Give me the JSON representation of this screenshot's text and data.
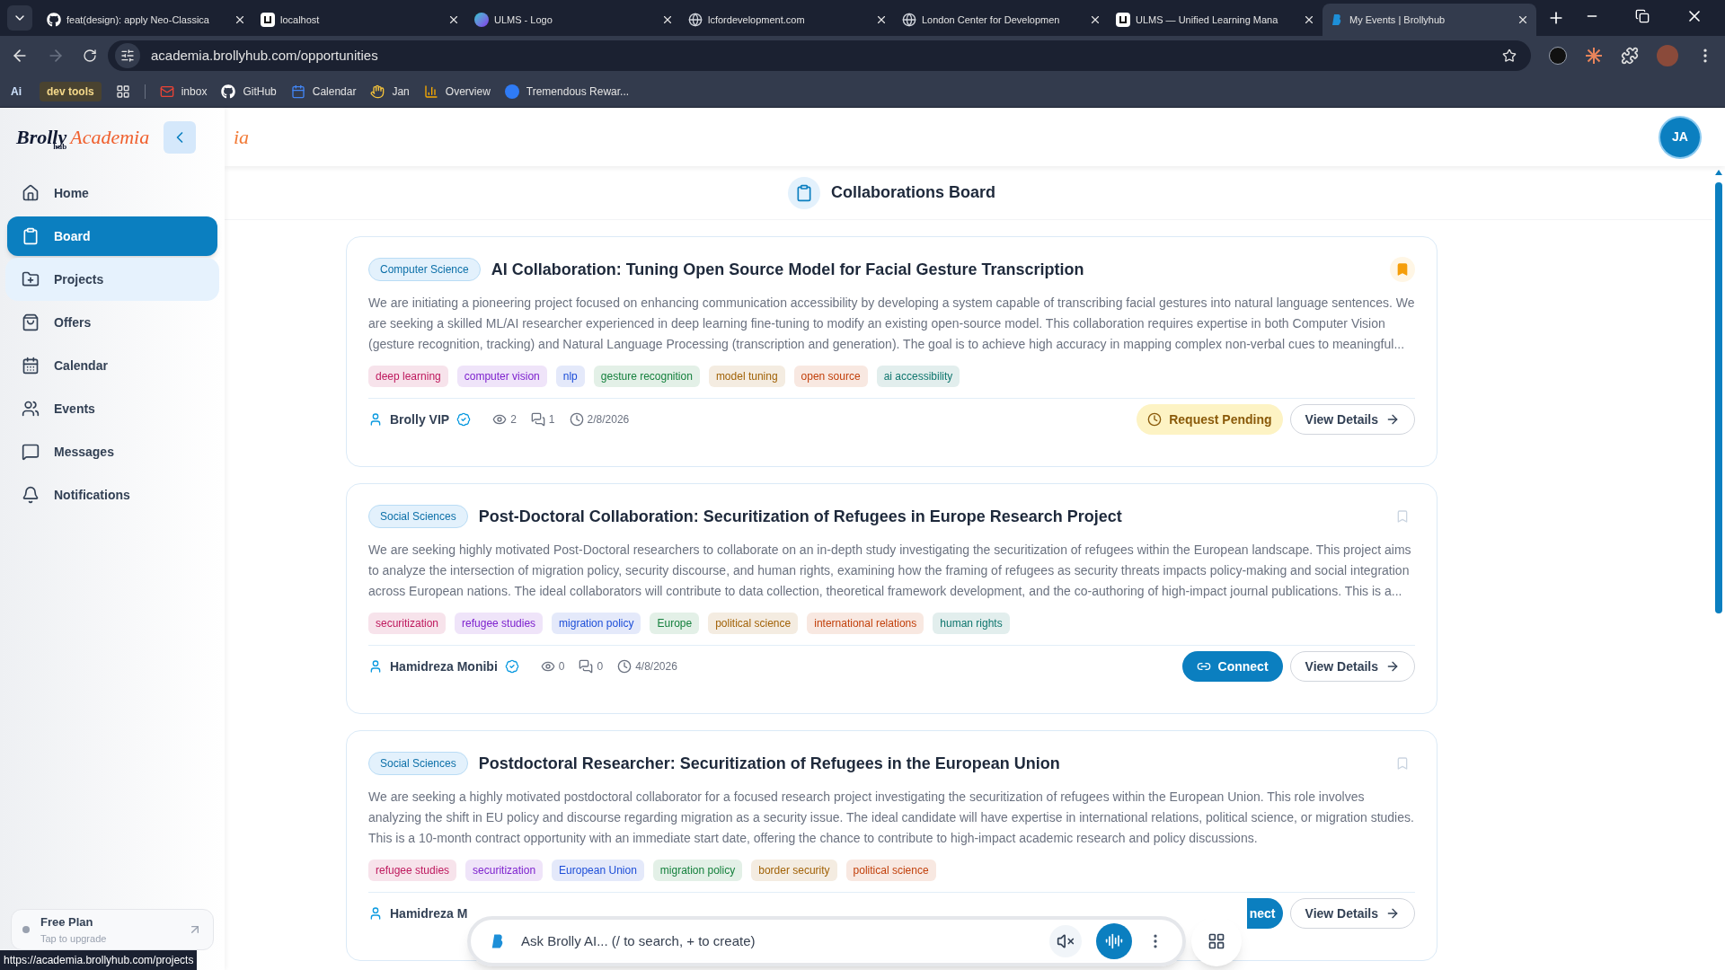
{
  "browser": {
    "tabs": [
      {
        "title": "feat(design): apply Neo-Classica",
        "selected": false,
        "kind": "github"
      },
      {
        "title": "localhost",
        "selected": false,
        "kind": "square"
      },
      {
        "title": "ULMS - Logo",
        "selected": false,
        "kind": "canva"
      },
      {
        "title": "lcfordevelopment.com",
        "selected": false,
        "kind": "globe"
      },
      {
        "title": "London Center for Developmen",
        "selected": false,
        "kind": "globe"
      },
      {
        "title": "ULMS — Unified Learning Mana",
        "selected": false,
        "kind": "square"
      },
      {
        "title": "My Events | Brollyhub",
        "selected": true,
        "kind": "brolly"
      }
    ],
    "url": "academia.brollyhub.com/opportunities",
    "bookmarks": [
      {
        "label": "Ai",
        "kind": "badge"
      },
      {
        "label": "dev tools",
        "kind": "folder"
      },
      {
        "label": "inbox",
        "kind": "mail"
      },
      {
        "label": "GitHub",
        "kind": "github"
      },
      {
        "label": "Calendar",
        "kind": "calendar"
      },
      {
        "label": "Jan",
        "kind": "wave"
      },
      {
        "label": "Overview",
        "kind": "chart"
      },
      {
        "label": "Tremendous Rewar...",
        "kind": "circle"
      }
    ]
  },
  "sidebar": {
    "logo": {
      "brand": "Brolly",
      "sub": "hub",
      "product": "Academia"
    },
    "items": [
      {
        "label": "Home",
        "selected": false,
        "hovered": false
      },
      {
        "label": "Board",
        "selected": true,
        "hovered": false
      },
      {
        "label": "Projects",
        "selected": false,
        "hovered": true
      },
      {
        "label": "Offers",
        "selected": false,
        "hovered": false
      },
      {
        "label": "Calendar",
        "selected": false,
        "hovered": false
      },
      {
        "label": "Events",
        "selected": false,
        "hovered": false
      },
      {
        "label": "Messages",
        "selected": false,
        "hovered": false
      },
      {
        "label": "Notifications",
        "selected": false,
        "hovered": false
      }
    ],
    "plan": {
      "title": "Free Plan",
      "subtitle": "Tap to upgrade"
    }
  },
  "header": {
    "logo_fragment": "ia",
    "avatar": "JA"
  },
  "page_title": "Collaborations Board",
  "cards": [
    {
      "category": "Computer Science",
      "title": "AI Collaboration: Tuning Open Source Model for Facial Gesture Transcription",
      "bookmarked": true,
      "description": "We are initiating a pioneering project focused on enhancing communication accessibility by developing a system capable of transcribing facial gestures into natural language sentences. We are seeking a skilled ML/AI researcher experienced in deep learning fine-tuning to modify an existing open-source model. This collaboration requires expertise in both Computer Vision (gesture recognition, tracking) and Natural Language Processing (transcription and generation). The goal is to achieve high accuracy in mapping complex non-verbal cues to meaningful...",
      "tags": [
        {
          "label": "deep learning",
          "color": "#be185d"
        },
        {
          "label": "computer vision",
          "color": "#7e22ce"
        },
        {
          "label": "nlp",
          "color": "#1d4ed8"
        },
        {
          "label": "gesture recognition",
          "color": "#15803d"
        },
        {
          "label": "model tuning",
          "color": "#a16207"
        },
        {
          "label": "open source",
          "color": "#c2410c"
        },
        {
          "label": "ai accessibility",
          "color": "#0f766e"
        }
      ],
      "author": "Brolly VIP",
      "author_verified": true,
      "views": "2",
      "comments": "1",
      "date": "2/8/2026",
      "action": {
        "kind": "pending",
        "label": "Request Pending"
      },
      "details": "View Details"
    },
    {
      "category": "Social Sciences",
      "title": "Post-Doctoral Collaboration: Securitization of Refugees in Europe Research Project",
      "bookmarked": false,
      "description": "We are seeking highly motivated Post-Doctoral researchers to collaborate on an in-depth study investigating the securitization of refugees within the European landscape. This project aims to analyze the intersection of migration policy, security discourse, and human rights, examining how the framing of refugees as security threats impacts policy-making and social integration across European nations. The ideal collaborators will contribute to data collection, theoretical framework development, and the co-authoring of high-impact journal publications. This is a...",
      "tags": [
        {
          "label": "securitization",
          "color": "#be185d"
        },
        {
          "label": "refugee studies",
          "color": "#7e22ce"
        },
        {
          "label": "migration policy",
          "color": "#1d4ed8"
        },
        {
          "label": "Europe",
          "color": "#15803d"
        },
        {
          "label": "political science",
          "color": "#a16207"
        },
        {
          "label": "international relations",
          "color": "#c2410c"
        },
        {
          "label": "human rights",
          "color": "#0f766e"
        }
      ],
      "author": "Hamidreza Monibi",
      "author_verified": true,
      "views": "0",
      "comments": "0",
      "date": "4/8/2026",
      "action": {
        "kind": "connect",
        "label": "Connect"
      },
      "details": "View Details"
    },
    {
      "category": "Social Sciences",
      "title": "Postdoctoral Researcher: Securitization of Refugees in the European Union",
      "bookmarked": false,
      "description": "We are seeking a highly motivated postdoctoral collaborator for a focused research project investigating the securitization of refugees within the European Union. This role involves analyzing the shift in EU policy and discourse regarding migration as a security issue. The ideal candidate will have expertise in international relations, political science, or migration studies. This is a 10-month contract opportunity with an immediate start date, offering the chance to contribute to high-impact academic research and policy discussions.",
      "tags": [
        {
          "label": "refugee studies",
          "color": "#be185d"
        },
        {
          "label": "securitization",
          "color": "#7e22ce"
        },
        {
          "label": "European Union",
          "color": "#1d4ed8"
        },
        {
          "label": "migration policy",
          "color": "#15803d"
        },
        {
          "label": "border security",
          "color": "#a16207"
        },
        {
          "label": "political science",
          "color": "#c2410c"
        }
      ],
      "author": "Hamidreza M",
      "author_verified": false,
      "action": {
        "kind": "connect",
        "label": "nect"
      },
      "details": "View Details"
    }
  ],
  "assistant_bar": {
    "placeholder": "Ask Brolly AI... (/ to search, + to create)"
  },
  "status_url": "https://academia.brollyhub.com/projects"
}
